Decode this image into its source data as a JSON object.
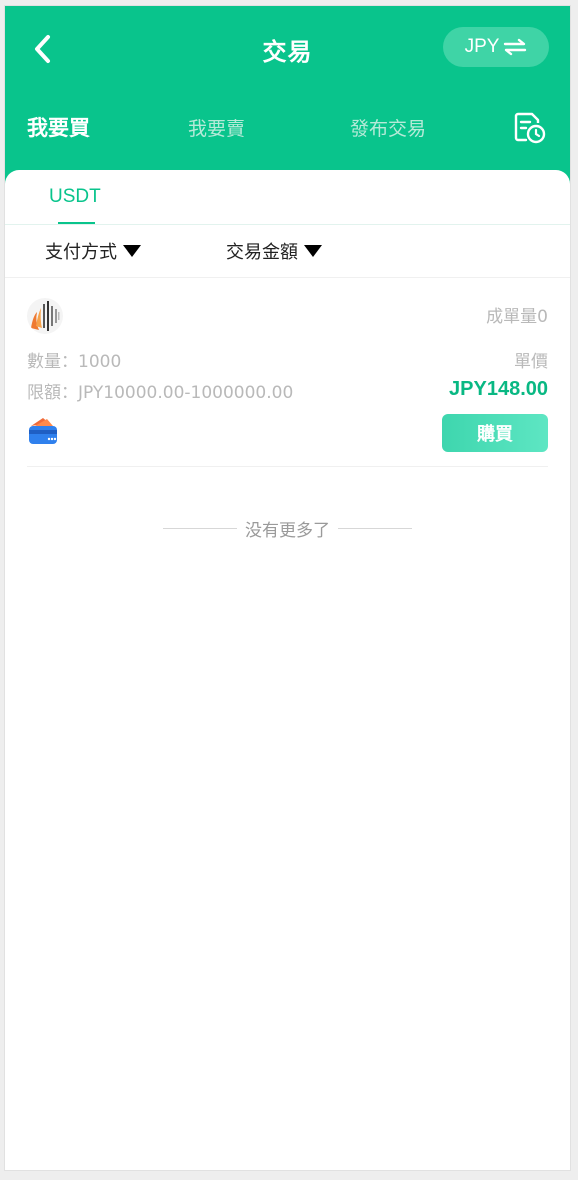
{
  "header": {
    "title": "交易",
    "currency_label": "JPY",
    "tabs": [
      {
        "label": "我要買",
        "active": true
      },
      {
        "label": "我要賣",
        "active": false
      },
      {
        "label": "發布交易",
        "active": false
      }
    ]
  },
  "coin_tab": {
    "label": "USDT"
  },
  "filters": [
    {
      "label": "支付方式"
    },
    {
      "label": "交易金額"
    }
  ],
  "listing": {
    "completed_label": "成單量0",
    "quantity": "數量：1000",
    "unit_price_label": "單價",
    "limit": "限額：JPY10000.00-1000000.00",
    "price": "JPY148.00",
    "buy_label": "購買"
  },
  "footer_text": "没有更多了",
  "colors": {
    "brand": "#09c48c",
    "price": "#09b883",
    "muted": "#b9b9b9"
  },
  "icons": [
    "back-icon",
    "swap-icon",
    "history-icon",
    "avatar",
    "wallet-icon",
    "caret-down-icon"
  ]
}
